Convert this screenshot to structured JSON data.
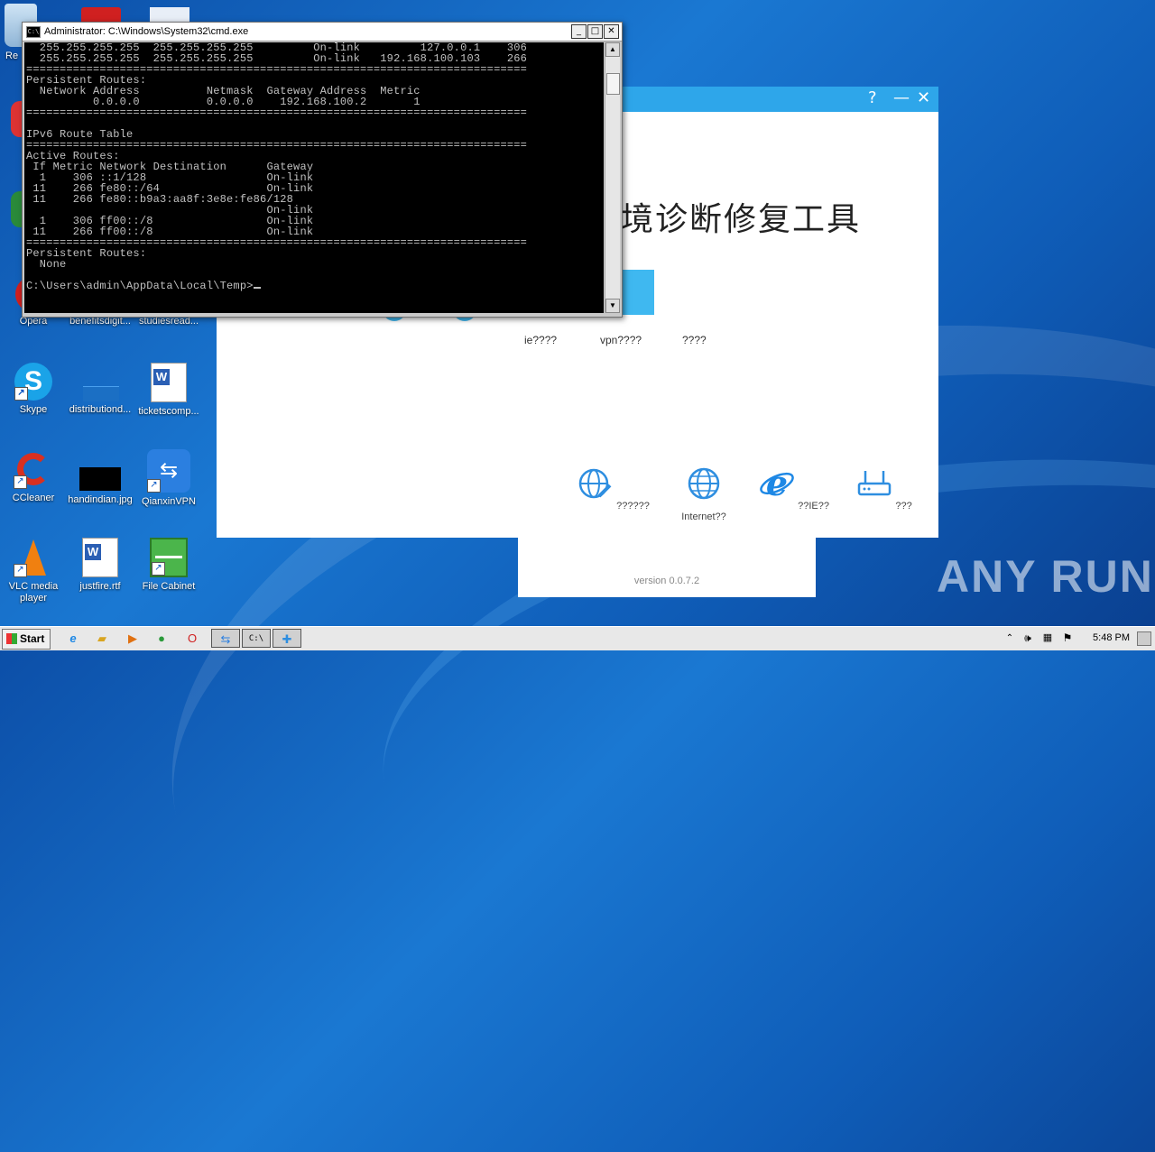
{
  "desktop": {
    "icons": [
      {
        "label": "Re",
        "name": "recycle-bin-icon"
      },
      {
        "label": "Opera",
        "name": "opera-icon"
      },
      {
        "label": "benefitsdigit...",
        "name": "word-doc-icon"
      },
      {
        "label": "studiesread...",
        "name": "word-doc-icon"
      },
      {
        "label": "Skype",
        "name": "skype-icon"
      },
      {
        "label": "distributiond...",
        "name": "folder-icon"
      },
      {
        "label": "ticketscomp...",
        "name": "word-doc-icon"
      },
      {
        "label": "CCleaner",
        "name": "ccleaner-icon"
      },
      {
        "label": "handindian.jpg",
        "name": "image-file-icon"
      },
      {
        "label": "QianxinVPN",
        "name": "vpn-icon"
      },
      {
        "label": "VLC media player",
        "name": "vlc-icon"
      },
      {
        "label": "justfire.rtf",
        "name": "word-doc-icon"
      },
      {
        "label": "File Cabinet",
        "name": "file-cabinet-icon"
      }
    ]
  },
  "cmd": {
    "title": "Administrator: C:\\Windows\\System32\\cmd.exe",
    "lines": [
      "  255.255.255.255  255.255.255.255         On-link         127.0.0.1    306",
      "  255.255.255.255  255.255.255.255         On-link   192.168.100.103    266",
      "===========================================================================",
      "Persistent Routes:",
      "  Network Address          Netmask  Gateway Address  Metric",
      "          0.0.0.0          0.0.0.0    192.168.100.2       1",
      "===========================================================================",
      "",
      "IPv6 Route Table",
      "===========================================================================",
      "Active Routes:",
      " If Metric Network Destination      Gateway",
      "  1    306 ::1/128                  On-link",
      " 11    266 fe80::/64                On-link",
      " 11    266 fe80::b9a3:aa8f:3e8e:fe86/128",
      "                                    On-link",
      "  1    306 ff00::/8                 On-link",
      " 11    266 ff00::/8                 On-link",
      "===========================================================================",
      "Persistent Routes:",
      "  None",
      "",
      "C:\\Users\\admin\\AppData\\Local\\Temp>"
    ]
  },
  "tool": {
    "title_partial": "境诊断修复工具",
    "options": [
      "ie????",
      "vpn????",
      "????"
    ],
    "bottom_items": [
      {
        "label": "??????",
        "icon": "web-edit-icon"
      },
      {
        "label": "Internet??",
        "icon": "globe-icon"
      },
      {
        "label": "??IE??",
        "icon": "ie-icon"
      },
      {
        "label": "???",
        "icon": "router-icon"
      }
    ],
    "version": "version 0.0.7.2",
    "accent": "#2ea6ea"
  },
  "taskbar": {
    "start_label": "Start",
    "clock": "5:48 PM"
  },
  "watermark": "ANY RUN"
}
